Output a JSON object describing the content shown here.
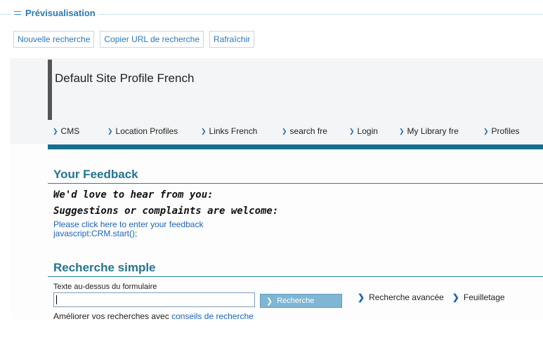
{
  "preview": {
    "title": "Prévisualisation",
    "buttons": [
      "Nouvelle recherche",
      "Copier URL de recherche",
      "Rafraîchir"
    ]
  },
  "site": {
    "title": "Default Site Profile French",
    "nav": [
      {
        "label": "CMS",
        "x": 0
      },
      {
        "label": "Location Profiles",
        "x": 0
      },
      {
        "label": "Links French",
        "x": 0
      },
      {
        "label": "search fre",
        "x": 0
      },
      {
        "label": "Login",
        "x": 0
      },
      {
        "label": "My Library fre",
        "x": 0
      },
      {
        "label": "Profiles",
        "x": 0
      }
    ]
  },
  "feedback": {
    "heading": "Your Feedback",
    "line1": "We'd love to hear from you:",
    "line2": "Suggestions or complaints are welcome:",
    "link": "Please click here to enter your feedback",
    "js": "javascript:CRM.start();"
  },
  "simple_search": {
    "heading": "Recherche simple",
    "label": "Texte au-dessus du formulaire",
    "input_value": "",
    "button": "Recherche",
    "improve_prefix": "Améliorer vos recherches avec",
    "improve_link": "conseils de recherche",
    "advanced": "Recherche avancée",
    "browse": "Feuilletage"
  },
  "colors": {
    "accent": "#237590",
    "nav_band": "#166f8f",
    "link": "#1d64b5",
    "button": "#7fb6d3"
  }
}
